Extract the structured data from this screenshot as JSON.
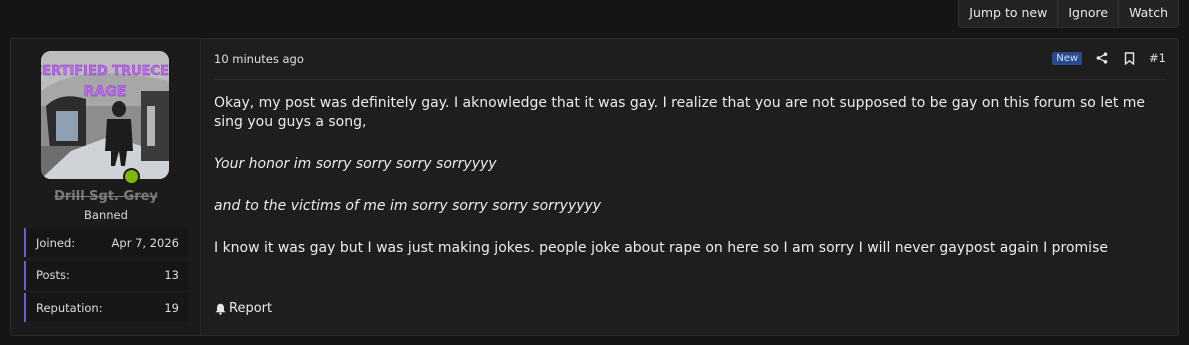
{
  "top_buttons": {
    "jump_to_new": "Jump to new",
    "ignore": "Ignore",
    "watch": "Watch"
  },
  "user": {
    "avatar_caption_line1": "CERTIFIED TRUECEL",
    "avatar_caption_line2": "RAGE",
    "username": "Drill Sgt. Grey",
    "title": "Banned",
    "status_color": "#7fb800",
    "stats": [
      {
        "label": "Joined:",
        "value": "Apr 7, 2026"
      },
      {
        "label": "Posts:",
        "value": "13"
      },
      {
        "label": "Reputation:",
        "value": "19"
      }
    ]
  },
  "post": {
    "date": "10 minutes ago",
    "badge": "New",
    "number": "#1",
    "paragraphs": [
      "Okay, my post was definitely gay. I aknowledge that it was gay. I realize that you are not supposed to be gay on this forum so let me sing you guys a song,",
      "Your honor im sorry sorry sorry sorryyyy",
      "and to the victims of me im sorry sorry sorry sorryyyyy",
      "I know it was gay but I was just making jokes. people joke about rape on here so I am sorry I will never gaypost again I promise"
    ],
    "report_label": "Report"
  },
  "colors": {
    "accent": "#6b5fcf",
    "badge": "#2b4a8e"
  },
  "icons": [
    "share-icon",
    "bookmark-icon",
    "bell-icon"
  ]
}
